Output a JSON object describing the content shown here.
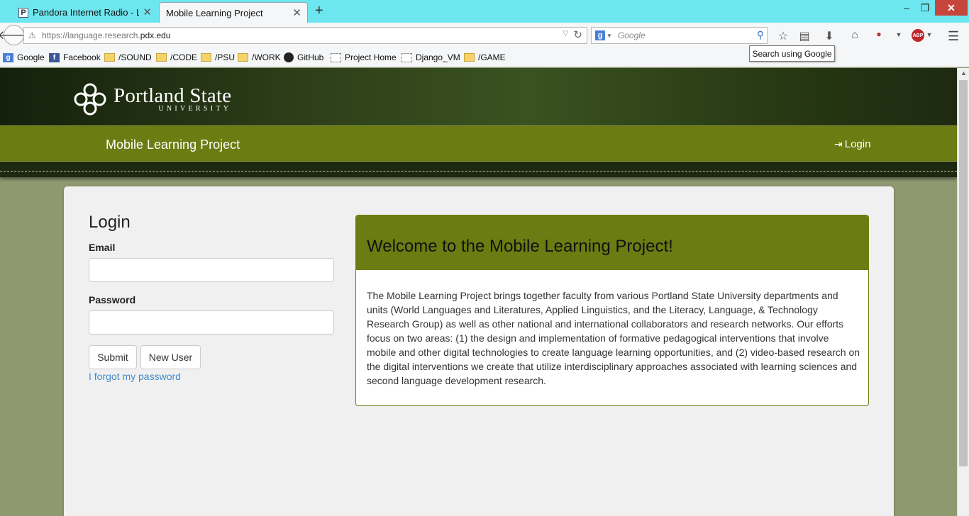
{
  "browser": {
    "tabs": [
      {
        "label": "Pandora Internet Radio - Li...",
        "favicon": "P",
        "active": false
      },
      {
        "label": "Mobile Learning Project",
        "active": true
      }
    ],
    "new_tab_symbol": "+",
    "url_prefix": "https://language.research.",
    "url_domain": "pdx.edu",
    "search_placeholder": "Google",
    "search_engine_letter": "g",
    "tooltip": "Search using Google",
    "abp_label": "ABP",
    "bookmarks": [
      {
        "label": "Google",
        "icon": "google-icon"
      },
      {
        "label": "Facebook",
        "icon": "facebook-icon"
      },
      {
        "label": "/SOUND",
        "icon": "folder-icon"
      },
      {
        "label": "/CODE",
        "icon": "folder-icon"
      },
      {
        "label": "/PSU",
        "icon": "folder-icon"
      },
      {
        "label": "/WORK",
        "icon": "folder-icon"
      },
      {
        "label": "GitHub",
        "icon": "github-icon"
      },
      {
        "label": "Project Home",
        "icon": "page-icon"
      },
      {
        "label": "Django_VM",
        "icon": "page-icon"
      },
      {
        "label": "/GAME",
        "icon": "folder-icon"
      }
    ]
  },
  "site": {
    "logo_name": "Portland State",
    "logo_sub": "UNIVERSITY",
    "title": "Mobile Learning Project",
    "login_link": "Login"
  },
  "login": {
    "heading": "Login",
    "email_label": "Email",
    "email_value": "",
    "password_label": "Password",
    "password_value": "",
    "submit_label": "Submit",
    "new_user_label": "New User",
    "forgot_label": "I forgot my password"
  },
  "welcome": {
    "title": "Welcome to the Mobile Learning Project!",
    "body": "The Mobile Learning Project brings together faculty from various Portland State University departments and units (World Languages and Literatures, Applied Linguistics, and the Literacy, Language, & Technology Research Group) as well as other national and international collaborators and research networks. Our efforts focus on two areas: (1) the design and implementation of formative pedagogical interventions that involve mobile and other digital technologies to create language learning opportunities, and (2) video-based research on the digital interventions we create that utilize interdisciplinary approaches associated with learning sciences and second language development research."
  },
  "colors": {
    "accent_olive": "#6b7c12",
    "page_background": "#8e9970",
    "link_blue": "#428bca",
    "titlebar": "#6ee6ef"
  }
}
